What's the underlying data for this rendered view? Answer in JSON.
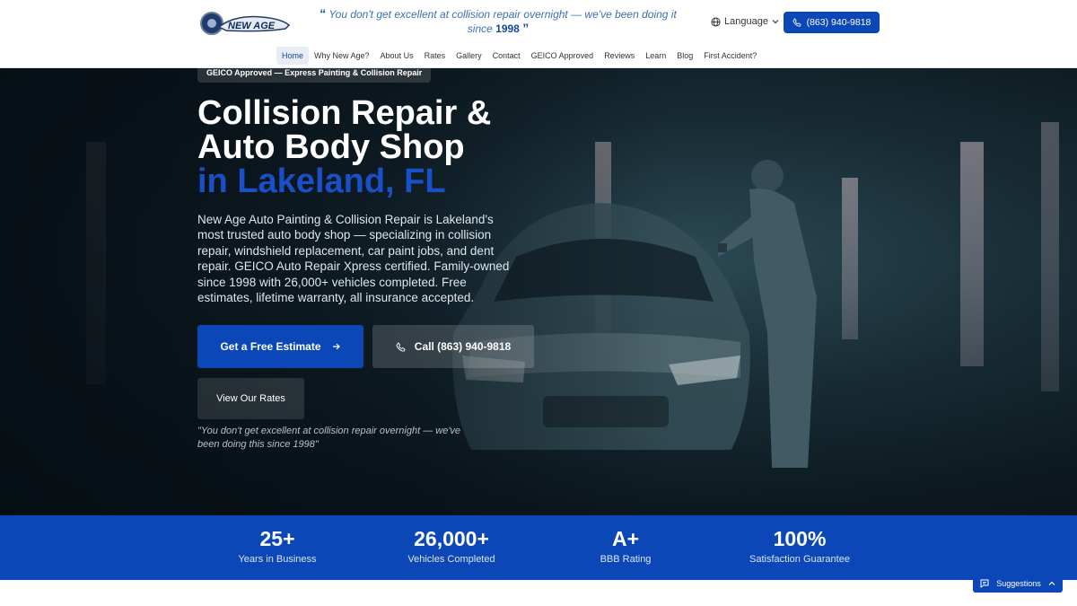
{
  "header": {
    "logo_text": "NEW AGE",
    "tagline_open": "“",
    "tagline_text": "You don't get excellent at collision repair overnight — we've been doing it since",
    "tagline_year": "1998",
    "tagline_close": "”",
    "language_label": "Language",
    "phone_button": "(863) 940-9818"
  },
  "nav": [
    {
      "label": "Home",
      "active": true
    },
    {
      "label": "Why New Age?"
    },
    {
      "label": "About Us"
    },
    {
      "label": "Rates"
    },
    {
      "label": "Gallery"
    },
    {
      "label": "Contact"
    },
    {
      "label": "GEICO Approved"
    },
    {
      "label": "Reviews"
    },
    {
      "label": "Learn"
    },
    {
      "label": "Blog"
    },
    {
      "label": "First Accident?"
    }
  ],
  "hero": {
    "badge": "GEICO Approved — Express Painting & Collision Repair",
    "title_line1": "Collision Repair &",
    "title_line2": "Auto Body Shop",
    "title_line3": "in Lakeland, FL",
    "description": "New Age Auto Painting & Collision Repair is Lakeland's most trusted auto body shop — specializing in collision repair, windshield replacement, car paint jobs, and dent repair. GEICO Auto Repair Xpress certified. Family-owned since 1998 with 26,000+ vehicles completed. Free estimates, lifetime warranty, all insurance accepted.",
    "estimate_button": "Get a Free Estimate",
    "call_button": "Call (863) 940-9818",
    "rates_button": "View Our Rates",
    "quote": "\"You don't get excellent at collision repair overnight — we've been doing this since 1998\""
  },
  "stats": [
    {
      "value": "25+",
      "label": "Years in Business"
    },
    {
      "value": "26,000+",
      "label": "Vehicles Completed"
    },
    {
      "value": "A+",
      "label": "BBB Rating"
    },
    {
      "value": "100%",
      "label": "Satisfaction Guarantee"
    }
  ],
  "suggestions": {
    "label": "Suggestions"
  },
  "colors": {
    "brand_blue": "#0c47b7",
    "title_blue": "#1a4fc8",
    "hero_dark": "#0d1a20"
  },
  "icons": [
    "globe-icon",
    "chevron-down-icon",
    "phone-icon",
    "arrow-right-icon",
    "chat-icon",
    "chevron-up-icon"
  ]
}
